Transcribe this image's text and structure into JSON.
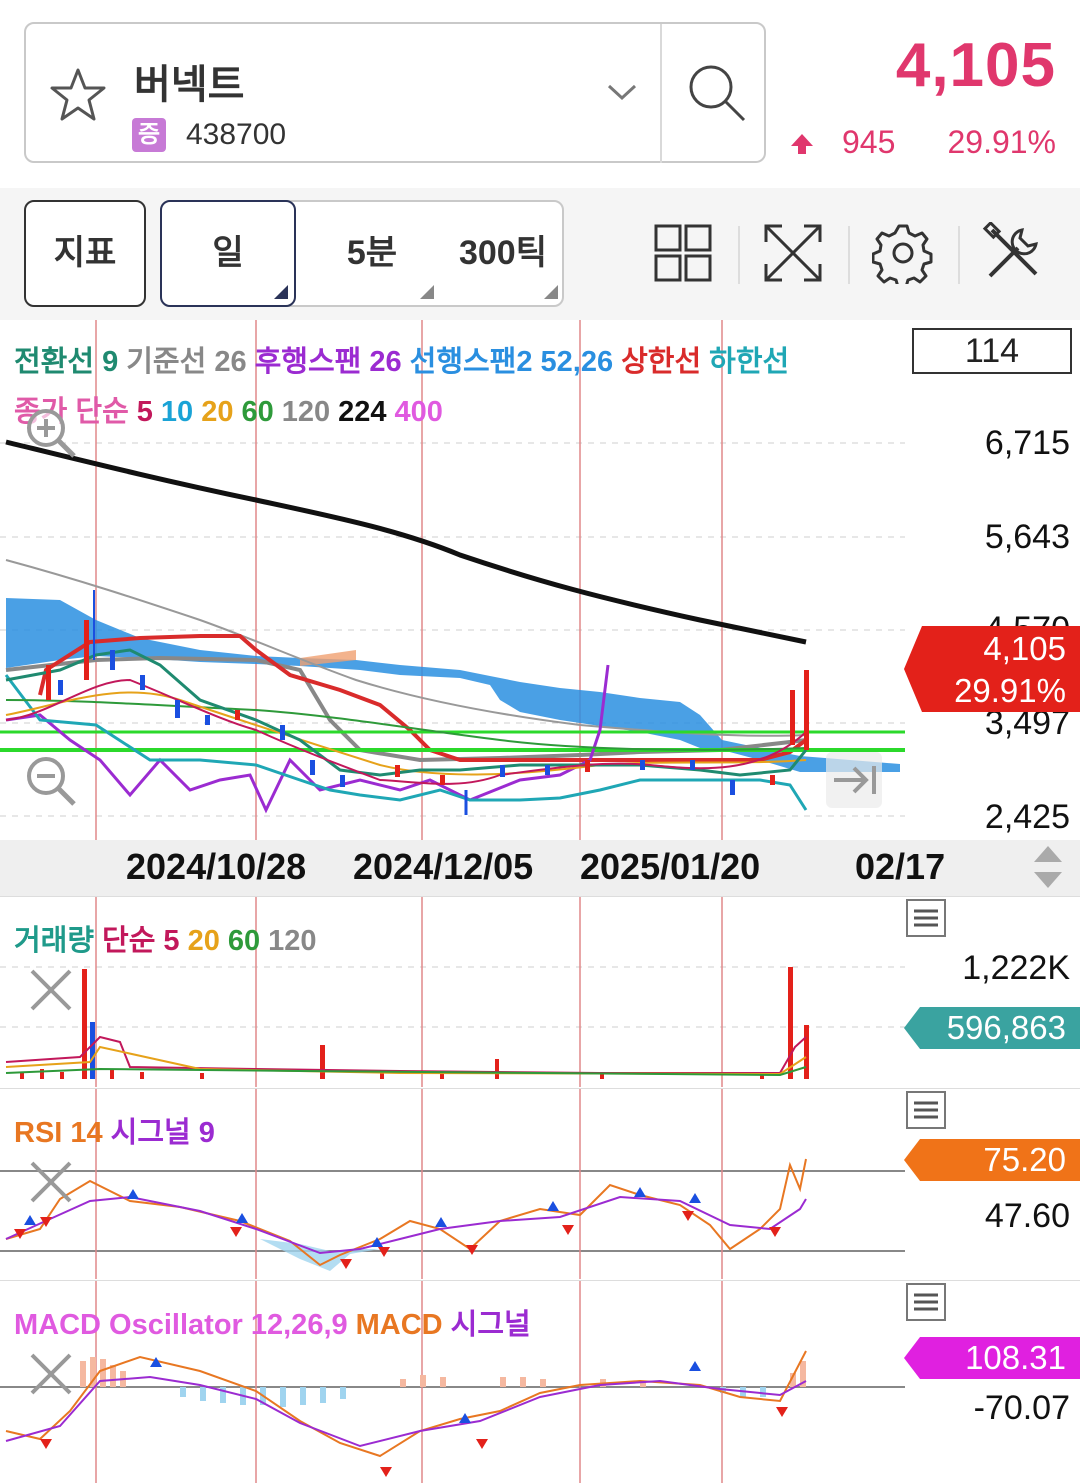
{
  "header": {
    "stock_name": "버넥트",
    "market_badge": "증",
    "stock_code": "438700",
    "price": "4,105",
    "change": "945",
    "change_rate": "29.91%",
    "accent_color": "#e0376d"
  },
  "toolbar": {
    "indicator_label": "지표",
    "periods": [
      "일",
      "5분",
      "300틱"
    ],
    "active_period": "일",
    "icons": [
      "grid-layout-icon",
      "expand-icon",
      "settings-gear-icon",
      "tools-icon"
    ]
  },
  "main_chart": {
    "box_value": "114",
    "legend_line1": [
      {
        "text": "전환선 9",
        "color": "#1f8a70"
      },
      {
        "text": "기준선 26",
        "color": "#888888"
      },
      {
        "text": "후행스팬 26",
        "color": "#9b2bd1"
      },
      {
        "text": "선행스팬2 52,26",
        "color": "#2a8fe0"
      },
      {
        "text": "상한선",
        "color": "#d92b2b"
      },
      {
        "text": "하한선",
        "color": "#1fa7b5"
      }
    ],
    "legend_line2": [
      {
        "text": "종가 단순",
        "color": "#e05aa8"
      },
      {
        "text": "5",
        "color": "#c2185b"
      },
      {
        "text": "10",
        "color": "#1aa3d6"
      },
      {
        "text": "20",
        "color": "#e6a21a"
      },
      {
        "text": "60",
        "color": "#2e9a3a"
      },
      {
        "text": "120",
        "color": "#888888"
      },
      {
        "text": "224",
        "color": "#111111"
      },
      {
        "text": "400",
        "color": "#e05ae0"
      }
    ],
    "y_labels": [
      "6,715",
      "5,643",
      "4,570",
      "3,497",
      "2,425"
    ],
    "current_price_tag": "4,105",
    "current_rate_tag": "29.91%",
    "tag_color": "#e3211a",
    "dates": [
      "2024/10/28",
      "2024/12/05",
      "2025/01/20",
      "02/17"
    ]
  },
  "volume_panel": {
    "legend": [
      {
        "text": "거래량",
        "color": "#1f9a8a"
      },
      {
        "text": "단순",
        "color": "#c2185b"
      },
      {
        "text": "5",
        "color": "#c2185b"
      },
      {
        "text": "20",
        "color": "#e6a21a"
      },
      {
        "text": "60",
        "color": "#2e9a3a"
      },
      {
        "text": "120",
        "color": "#888888"
      }
    ],
    "y_label": "1,222K",
    "tag": "596,863",
    "tag_color": "#3aa3a0"
  },
  "rsi_panel": {
    "legend": [
      {
        "text": "RSI 14",
        "color": "#e87722"
      },
      {
        "text": "시그널 9",
        "color": "#9b2bd1"
      }
    ],
    "tag": "75.20",
    "tag_color": "#f07318",
    "y_label": "47.60"
  },
  "macd_panel": {
    "legend": [
      {
        "text": "MACD Oscillator 12,26,9",
        "color": "#e05ae0"
      },
      {
        "text": "MACD",
        "color": "#e87722"
      },
      {
        "text": "시그널",
        "color": "#9b2bd1"
      }
    ],
    "tag": "108.31",
    "tag_color": "#e020e0",
    "y_label": "-70.07"
  }
}
